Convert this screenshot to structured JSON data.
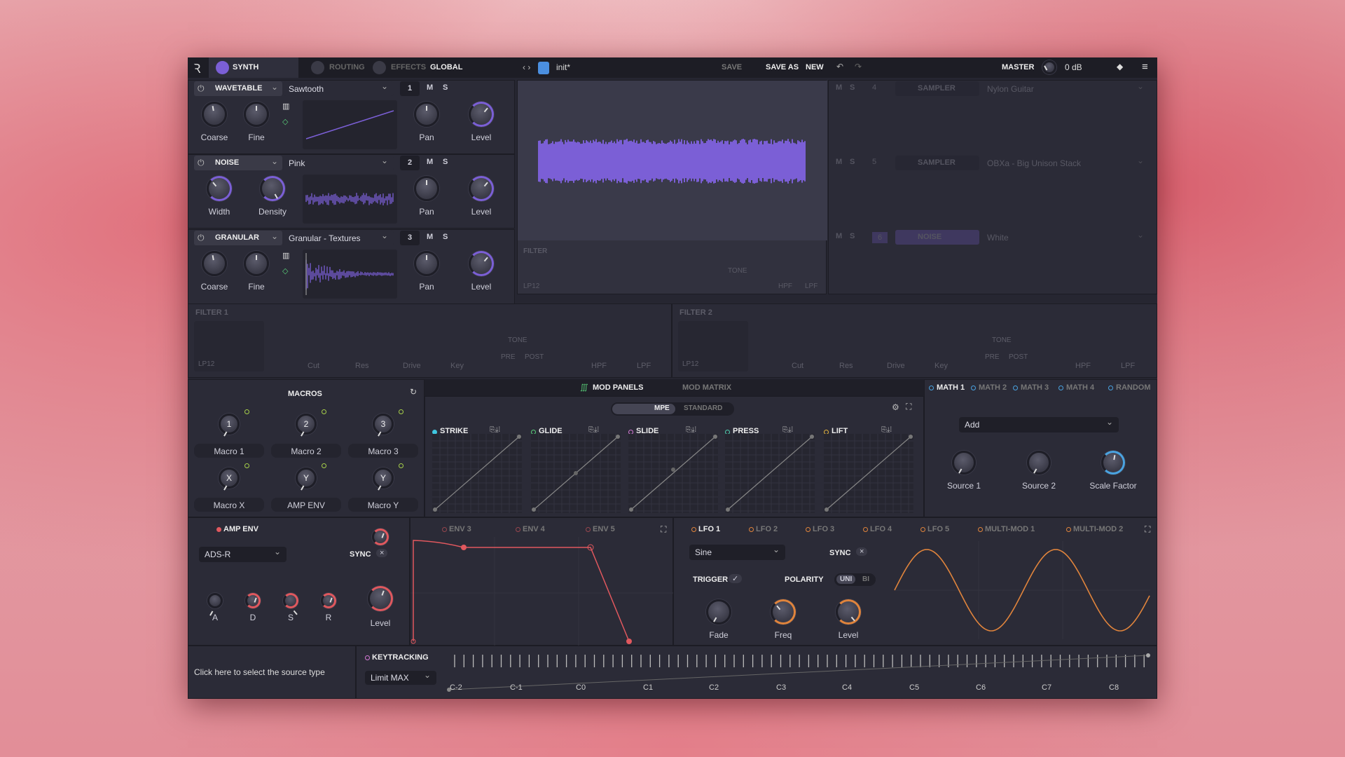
{
  "topbar": {
    "tabs": [
      "SYNTH",
      "ROUTING",
      "EFFECTS",
      "GLOBAL"
    ],
    "preset": "init*",
    "save": "SAVE",
    "save_as": "SAVE AS",
    "new": "NEW",
    "master": "MASTER",
    "master_value": "0 dB"
  },
  "osc_labels": {
    "mute": "M",
    "solo": "S"
  },
  "oscillators": [
    {
      "type": "WAVETABLE",
      "source": "Sawtooth",
      "number": "1",
      "knobs": [
        "Coarse",
        "Fine",
        "Pan",
        "Level"
      ]
    },
    {
      "type": "NOISE",
      "source": "Pink",
      "number": "2",
      "knobs": [
        "Width",
        "Density",
        "Pan",
        "Level"
      ]
    },
    {
      "type": "GRANULAR",
      "source": "Granular - Textures",
      "number": "3",
      "knobs": [
        "Coarse",
        "Fine",
        "Pan",
        "Level"
      ]
    }
  ],
  "faded_oscillators": [
    {
      "number": "4",
      "type": "SAMPLER",
      "source": "Nylon Guitar"
    },
    {
      "number": "5",
      "type": "SAMPLER",
      "source": "OBXa - Big Unison Stack"
    },
    {
      "number": "6",
      "type": "NOISE",
      "source": "White"
    }
  ],
  "filters": {
    "mid": "FILTER",
    "f1": "FILTER 1",
    "f2": "FILTER 2",
    "mode": "LP12",
    "knobs": [
      "Cut",
      "Res",
      "Drive",
      "Key"
    ],
    "tone": "TONE",
    "pre": "PRE",
    "post": "POST",
    "hpf": "HPF",
    "lpf": "LPF"
  },
  "mod_tabs": [
    "MOD PANELS",
    "MOD MATRIX"
  ],
  "macros": {
    "title": "MACROS",
    "items": [
      {
        "glyph": "1",
        "label": "Macro 1"
      },
      {
        "glyph": "2",
        "label": "Macro 2"
      },
      {
        "glyph": "3",
        "label": "Macro 3"
      },
      {
        "glyph": "X",
        "label": "Macro X"
      },
      {
        "glyph": "Y",
        "label": "AMP ENV"
      },
      {
        "glyph": "Y",
        "label": "Macro Y"
      }
    ]
  },
  "mpe": {
    "options": [
      "MPE",
      "STANDARD"
    ],
    "panels": [
      {
        "name": "STRIKE",
        "color": "#3fc6e0"
      },
      {
        "name": "GLIDE",
        "color": "#5ad27a"
      },
      {
        "name": "SLIDE",
        "color": "#d67ad6"
      },
      {
        "name": "PRESS",
        "color": "#4fd0b0"
      },
      {
        "name": "LIFT",
        "color": "#e3b43c"
      }
    ]
  },
  "math": {
    "tabs": [
      "MATH 1",
      "MATH 2",
      "MATH 3",
      "MATH 4",
      "RANDOM"
    ],
    "operation": "Add",
    "knobs": [
      "Source 1",
      "Source 2",
      "Scale Factor"
    ]
  },
  "amp_env": {
    "title": "AMP ENV",
    "mode": "ADS-R",
    "sync": "SYNC",
    "knobs": [
      "A",
      "D",
      "S",
      "R",
      "Level"
    ],
    "tabs": [
      "ENV 3",
      "ENV 4",
      "ENV 5"
    ]
  },
  "lfo": {
    "tabs": [
      "LFO 1",
      "LFO 2",
      "LFO 3",
      "LFO 4",
      "LFO 5",
      "MULTI-MOD 1",
      "MULTI-MOD 2"
    ],
    "shape": "Sine",
    "sync": "SYNC",
    "trigger": "TRIGGER",
    "polarity": "POLARITY",
    "uni": "UNI",
    "bi": "BI",
    "knobs": [
      "Fade",
      "Freq",
      "Level"
    ]
  },
  "bottom": {
    "source_hint": "Click here to select the source type",
    "keytracking": "KEYTRACKING",
    "limit": "Limit MAX",
    "notes": [
      "C-2",
      "C-1",
      "C0",
      "C1",
      "C2",
      "C3",
      "C4",
      "C5",
      "C6",
      "C7",
      "C8"
    ]
  },
  "colors": {
    "accent": "#7b5fd6",
    "env": "#e0585e",
    "lfo": "#e0843c",
    "math": "#4aa3e0"
  }
}
